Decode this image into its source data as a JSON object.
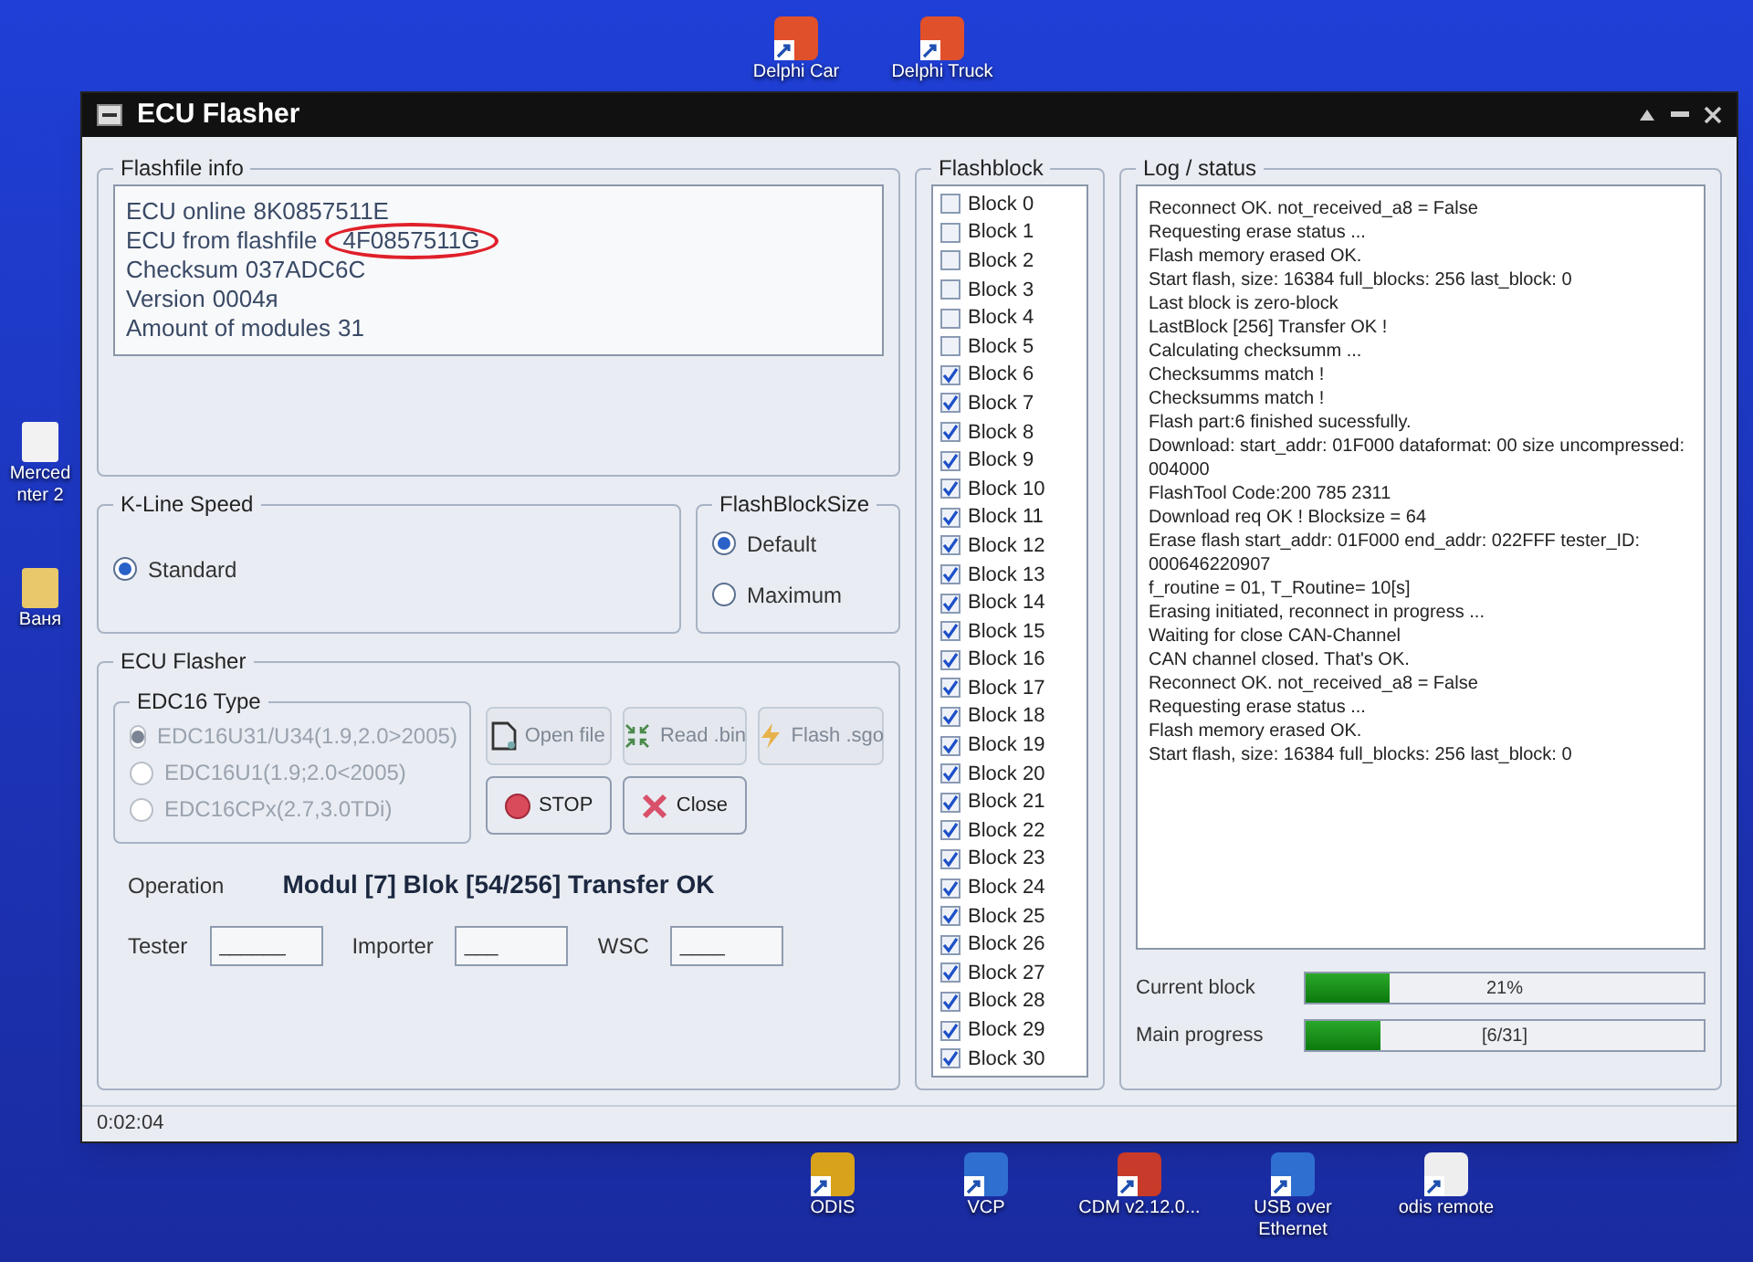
{
  "desktop_top_icons": [
    {
      "label": "Delphi Car",
      "color": "#e0502a"
    },
    {
      "label": "Delphi Truck",
      "color": "#e0502a"
    }
  ],
  "desktop_left_icons": [
    {
      "label": "Merced nter 2",
      "color": "#f2f2f2"
    },
    {
      "label": "Ваня",
      "color": "#e8c86a"
    }
  ],
  "window": {
    "title": "ECU Flasher",
    "flashfile_info": {
      "title": "Flashfile info",
      "lines": [
        {
          "label": "ECU online",
          "value": "8K0857511E",
          "circled": false
        },
        {
          "label": "ECU from flashfile",
          "value": "4F0857511G",
          "circled": true
        },
        {
          "label": "Checksum",
          "value": "037ADC6C",
          "circled": false
        },
        {
          "label": "Version",
          "value": "0004я",
          "circled": false
        },
        {
          "label": "Amount of modules",
          "value": "31",
          "circled": false
        }
      ]
    },
    "kline_speed": {
      "title": "K-Line Speed",
      "options": [
        {
          "label": "Standard",
          "selected": true
        }
      ]
    },
    "flash_block_size": {
      "title": "FlashBlockSize",
      "options": [
        {
          "label": "Default",
          "selected": true
        },
        {
          "label": "Maximum",
          "selected": false
        }
      ]
    },
    "ecu_flasher": {
      "title": "ECU Flasher",
      "edc16_type": {
        "title": "EDC16 Type",
        "options": [
          {
            "label": "EDC16U31/U34(1.9,2.0>2005)",
            "selected": true,
            "disabled": true
          },
          {
            "label": "EDC16U1(1.9;2.0<2005)",
            "selected": false,
            "disabled": true
          },
          {
            "label": "EDC16CPx(2.7,3.0TDi)",
            "selected": false,
            "disabled": true
          }
        ]
      },
      "buttons": [
        {
          "label": "Open file",
          "kind": "file",
          "disabled": true
        },
        {
          "label": "Read .bin",
          "kind": "read",
          "disabled": true
        },
        {
          "label": "Flash .sgo",
          "kind": "flash",
          "disabled": true
        },
        {
          "label": "STOP",
          "kind": "stop",
          "disabled": false
        },
        {
          "label": "Close",
          "kind": "close",
          "disabled": false
        }
      ],
      "operation": {
        "label": "Operation",
        "value": "Modul [7] Blok [54/256] Transfer OK"
      },
      "fields": [
        {
          "label": "Tester",
          "value": "______"
        },
        {
          "label": "Importer",
          "value": "___"
        },
        {
          "label": "WSC",
          "value": "____"
        }
      ]
    },
    "flashblock": {
      "title": "Flashblock",
      "blocks": [
        {
          "label": "Block 0",
          "checked": false
        },
        {
          "label": "Block 1",
          "checked": false
        },
        {
          "label": "Block 2",
          "checked": false
        },
        {
          "label": "Block 3",
          "checked": false
        },
        {
          "label": "Block 4",
          "checked": false
        },
        {
          "label": "Block 5",
          "checked": false
        },
        {
          "label": "Block 6",
          "checked": true
        },
        {
          "label": "Block 7",
          "checked": true
        },
        {
          "label": "Block 8",
          "checked": true
        },
        {
          "label": "Block 9",
          "checked": true
        },
        {
          "label": "Block 10",
          "checked": true
        },
        {
          "label": "Block 11",
          "checked": true
        },
        {
          "label": "Block 12",
          "checked": true
        },
        {
          "label": "Block 13",
          "checked": true
        },
        {
          "label": "Block 14",
          "checked": true
        },
        {
          "label": "Block 15",
          "checked": true
        },
        {
          "label": "Block 16",
          "checked": true
        },
        {
          "label": "Block 17",
          "checked": true
        },
        {
          "label": "Block 18",
          "checked": true
        },
        {
          "label": "Block 19",
          "checked": true
        },
        {
          "label": "Block 20",
          "checked": true
        },
        {
          "label": "Block 21",
          "checked": true
        },
        {
          "label": "Block 22",
          "checked": true
        },
        {
          "label": "Block 23",
          "checked": true
        },
        {
          "label": "Block 24",
          "checked": true
        },
        {
          "label": "Block 25",
          "checked": true
        },
        {
          "label": "Block 26",
          "checked": true
        },
        {
          "label": "Block 27",
          "checked": true
        },
        {
          "label": "Block 28",
          "checked": true
        },
        {
          "label": "Block 29",
          "checked": true
        },
        {
          "label": "Block 30",
          "checked": true
        }
      ]
    },
    "log": {
      "title": "Log / status",
      "lines": [
        "Reconnect OK. not_received_a8 = False",
        "Requesting erase status ...",
        "Flash memory erased OK.",
        "Start flash, size: 16384 full_blocks: 256 last_block: 0",
        "Last block is zero-block",
        "LastBlock [256] Transfer OK !",
        "Calculating checksumm ...",
        "Checksumms match !",
        "Checksumms match !",
        "Flash part:6 finished sucessfully.",
        "Download: start_addr: 01F000 dataformat: 00 size uncompressed: 004000",
        "FlashTool Code:200 785 2311",
        "Download req OK ! Blocksize = 64",
        "Erase flash start_addr: 01F000 end_addr: 022FFF tester_ID: 000646220907",
        "f_routine = 01, T_Routine= 10[s]",
        "Erasing initiated, reconnect in progress ...",
        "Waiting for close CAN-Channel",
        "CAN channel closed. That's OK.",
        "Reconnect OK. not_received_a8 = False",
        "Requesting erase status ...",
        "Flash memory erased OK.",
        "Start flash, size: 16384 full_blocks: 256 last_block: 0"
      ]
    },
    "progress": [
      {
        "label": "Current block",
        "level": 0.21,
        "reading": "21%"
      },
      {
        "label": "Main progress",
        "level": 0.19,
        "reading": "[6/31]"
      }
    ],
    "status_bar": {
      "time": "0:02:04"
    }
  },
  "desktop_bottom_icons": [
    {
      "label": "ODIS",
      "color": "#d9a21b"
    },
    {
      "label": "VCP",
      "color": "#2f6fd0"
    },
    {
      "label": "CDM v2.12.0...",
      "color": "#c83a2a"
    },
    {
      "label": "USB over Ethernet",
      "color": "#2f6fd0"
    },
    {
      "label": "odis remote",
      "color": "#eeeeee"
    }
  ]
}
